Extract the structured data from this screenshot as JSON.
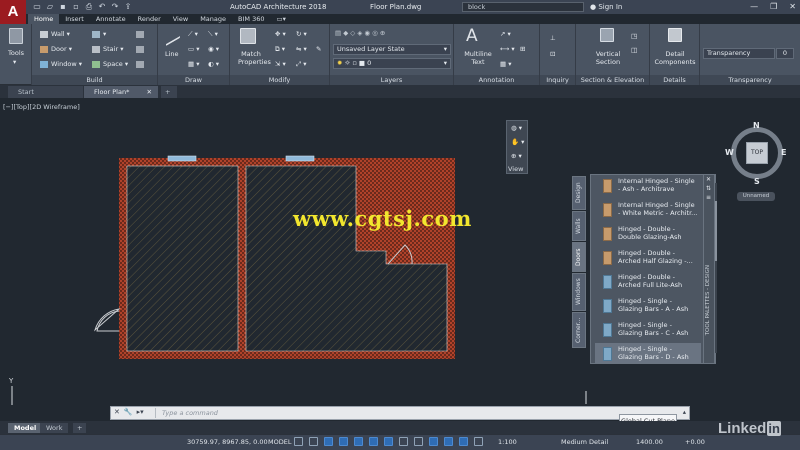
{
  "app": {
    "logo_letter": "A",
    "title": "AutoCAD Architecture 2018",
    "document": "Floor Plan.dwg",
    "search_text": "block",
    "sign_in": "Sign In",
    "window_buttons": [
      "—",
      "❐",
      "✕"
    ]
  },
  "ribbon_tabs": [
    "Home",
    "Insert",
    "Annotate",
    "Render",
    "View",
    "Manage",
    "BIM 360"
  ],
  "ribbon": {
    "tools": {
      "label": "Tools"
    },
    "build": {
      "title": "Build",
      "items": [
        "Wall",
        "Door",
        "Window",
        "Stair",
        "Space"
      ]
    },
    "draw": {
      "title": "Draw",
      "line_label": "Line"
    },
    "modify": {
      "title": "Modify",
      "match_label": "Match Properties"
    },
    "layers": {
      "title": "Layers",
      "layer_state": "Unsaved Layer State",
      "current_layer": "0"
    },
    "annotation": {
      "title": "Annotation",
      "multiline_label": "Multiline Text"
    },
    "inquiry": {
      "title": "Inquiry"
    },
    "section": {
      "title": "Section & Elevation",
      "vertical_label": "Vertical Section"
    },
    "details": {
      "title": "Details",
      "components_label": "Detail Components"
    },
    "transparency": {
      "title": "Transparency",
      "label": "Transparency",
      "value": "0"
    }
  },
  "file_tabs": [
    "Start",
    "Floor Plan*"
  ],
  "viewport_label": "[−][Top][2D Wireframe]",
  "navbar_label": "View",
  "viewcube": {
    "face": "TOP",
    "n": "N",
    "s": "S",
    "e": "E",
    "w": "W",
    "wcs": "Unnamed"
  },
  "watermark": "www.cgtsj.com",
  "palette": {
    "side_title": "TOOL PALETTES - DESIGN",
    "tabs": [
      "Design",
      "Walls",
      "Doors",
      "Windows",
      "Corner..."
    ],
    "active_tab": "Doors",
    "items": [
      {
        "line1": "Internal Hinged - Single",
        "line2": "- Ash - Architrave",
        "icon": "door-wood-icon"
      },
      {
        "line1": "Internal Hinged - Single",
        "line2": "- White Metric - Architr...",
        "icon": "door-wood-icon"
      },
      {
        "line1": "Hinged - Double -",
        "line2": "Double Glazing-Ash",
        "icon": "door-wood-icon"
      },
      {
        "line1": "Hinged - Double -",
        "line2": "Arched Half Glazing -...",
        "icon": "door-wood-icon"
      },
      {
        "line1": "Hinged - Double -",
        "line2": "Arched Full Lite-Ash",
        "icon": "door-glass-icon"
      },
      {
        "line1": "Hinged - Single -",
        "line2": "Glazing Bars - A - Ash",
        "icon": "door-glass-icon"
      },
      {
        "line1": "Hinged - Single -",
        "line2": "Glazing Bars - C - Ash",
        "icon": "door-glass-icon"
      },
      {
        "line1": "Hinged - Single -",
        "line2": "Glazing Bars - D - Ash",
        "icon": "door-glass-icon"
      }
    ]
  },
  "command_line": {
    "placeholder": "Type a command"
  },
  "tooltip": "Global Cut Plane",
  "layout_tabs": [
    "Model",
    "Work"
  ],
  "status": {
    "coords": "30759.97, 8967.85, 0.00",
    "space": "MODEL",
    "scale": "1:100",
    "detail": "Medium Detail",
    "cut_plane": "1400.00",
    "elevation": "+0.00"
  },
  "branding": {
    "linkedin": "Linked",
    "in": "in"
  }
}
